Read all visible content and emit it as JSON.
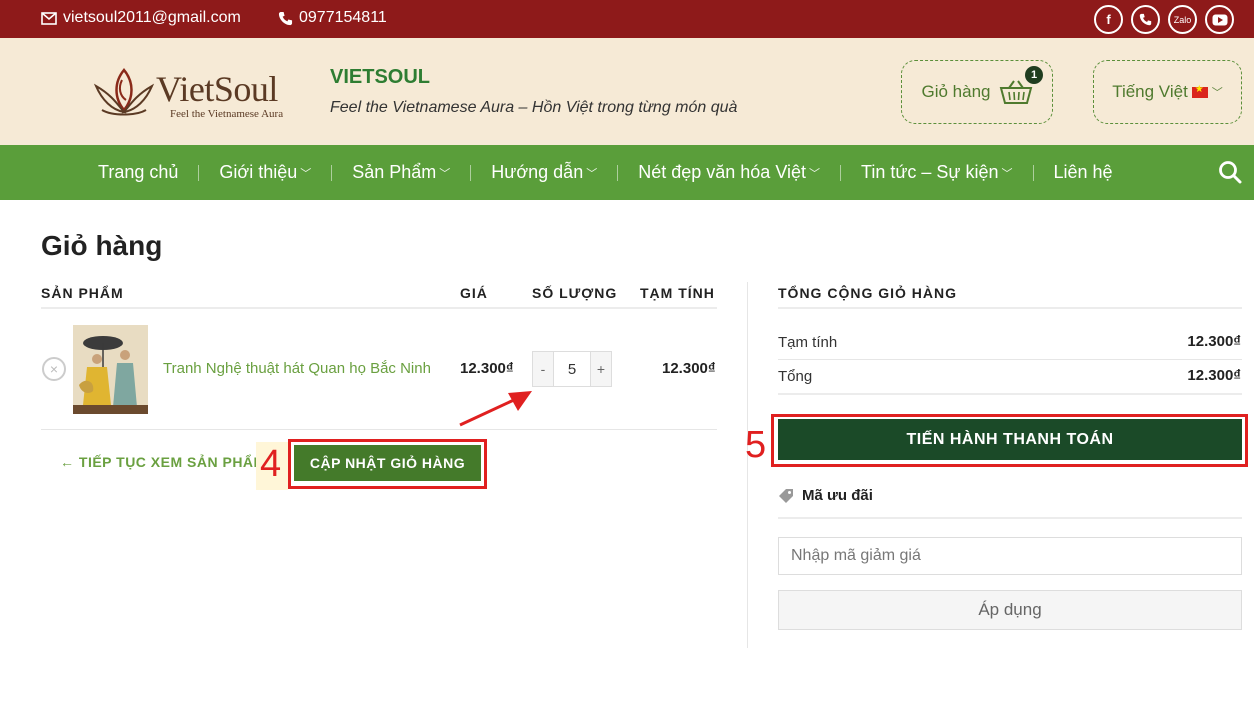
{
  "topbar": {
    "email": "vietsoul2011@gmail.com",
    "phone": "0977154811",
    "socials": [
      "facebook-icon",
      "phone-icon",
      "Zalo",
      "youtube-icon"
    ],
    "zalo_label": "Zalo"
  },
  "header": {
    "logo_text": "VietSoul",
    "logo_tagline": "Feel the Vietnamese Aura",
    "brand_title": "VIETSOUL",
    "brand_subtitle": "Feel the Vietnamese Aura – Hồn Việt trong từng món quà",
    "cart_label": "Giỏ hàng",
    "cart_count": "1",
    "language": "Tiếng Việt"
  },
  "nav": {
    "items": [
      {
        "label": "Trang chủ",
        "dropdown": false
      },
      {
        "label": "Giới thiệu",
        "dropdown": true
      },
      {
        "label": "Sản Phẩm",
        "dropdown": true
      },
      {
        "label": "Hướng dẫn",
        "dropdown": true
      },
      {
        "label": "Nét đẹp văn hóa Việt",
        "dropdown": true
      },
      {
        "label": "Tin tức – Sự kiện",
        "dropdown": true
      },
      {
        "label": "Liên hệ",
        "dropdown": false
      }
    ]
  },
  "cart": {
    "title": "Giỏ hàng",
    "columns": {
      "product": "SẢN PHẨM",
      "price": "GIÁ",
      "quantity": "SỐ LƯỢNG",
      "subtotal": "TẠM TÍNH"
    },
    "items": [
      {
        "name": "Tranh Nghệ thuật hát Quan họ Bắc Ninh",
        "price": "12.300₫",
        "quantity": "5",
        "subtotal": "12.300₫"
      }
    ],
    "qty_minus": "-",
    "qty_plus": "+",
    "continue_label": "← TIẾP TỤC XEM SẢN PHẨM",
    "update_label": "CẬP NHẬT GIỎ HÀNG",
    "step_update": "4"
  },
  "totals": {
    "title": "TỔNG CỘNG GIỎ HÀNG",
    "subtotal_label": "Tạm tính",
    "subtotal_value": "12.300₫",
    "total_label": "Tổng",
    "total_value": "12.300₫",
    "checkout_label": "TIẾN HÀNH THANH TOÁN",
    "step_checkout": "5",
    "coupon_label": "Mã ưu đãi",
    "coupon_placeholder": "Nhập mã giảm giá",
    "apply_label": "Áp dụng"
  },
  "colors": {
    "topbar": "#8e1a1a",
    "header_bg": "#f6ead6",
    "nav_bg": "#5a9e3a",
    "update_button": "#447a2a",
    "checkout_button": "#1b4a28",
    "annotation_red": "#e02020"
  }
}
